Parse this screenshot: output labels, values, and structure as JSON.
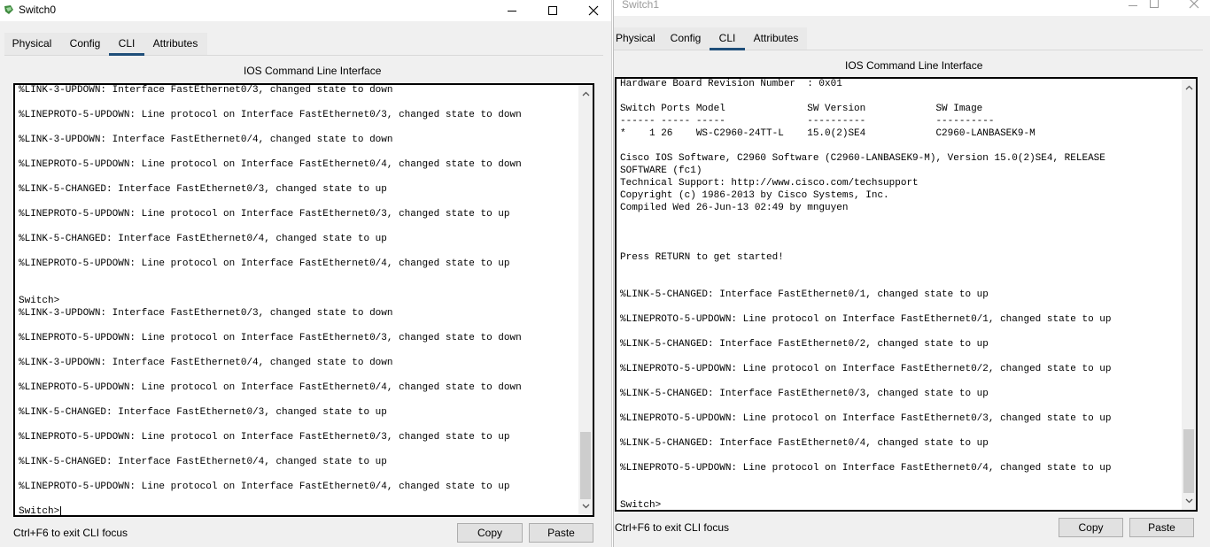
{
  "switch0": {
    "title": "Switch0",
    "tabs": [
      {
        "label": "Physical",
        "active": false
      },
      {
        "label": "Config",
        "active": false
      },
      {
        "label": "CLI",
        "active": true
      },
      {
        "label": "Attributes",
        "active": false
      }
    ],
    "section_title": "IOS Command Line Interface",
    "cli_lines": [
      "%LINK-3-UPDOWN: Interface FastEthernet0/3, changed state to down",
      "",
      "%LINEPROTO-5-UPDOWN: Line protocol on Interface FastEthernet0/3, changed state to down",
      "",
      "%LINK-3-UPDOWN: Interface FastEthernet0/4, changed state to down",
      "",
      "%LINEPROTO-5-UPDOWN: Line protocol on Interface FastEthernet0/4, changed state to down",
      "",
      "%LINK-5-CHANGED: Interface FastEthernet0/3, changed state to up",
      "",
      "%LINEPROTO-5-UPDOWN: Line protocol on Interface FastEthernet0/3, changed state to up",
      "",
      "%LINK-5-CHANGED: Interface FastEthernet0/4, changed state to up",
      "",
      "%LINEPROTO-5-UPDOWN: Line protocol on Interface FastEthernet0/4, changed state to up",
      "",
      "",
      "Switch>",
      "%LINK-3-UPDOWN: Interface FastEthernet0/3, changed state to down",
      "",
      "%LINEPROTO-5-UPDOWN: Line protocol on Interface FastEthernet0/3, changed state to down",
      "",
      "%LINK-3-UPDOWN: Interface FastEthernet0/4, changed state to down",
      "",
      "%LINEPROTO-5-UPDOWN: Line protocol on Interface FastEthernet0/4, changed state to down",
      "",
      "%LINK-5-CHANGED: Interface FastEthernet0/3, changed state to up",
      "",
      "%LINEPROTO-5-UPDOWN: Line protocol on Interface FastEthernet0/3, changed state to up",
      "",
      "%LINK-5-CHANGED: Interface FastEthernet0/4, changed state to up",
      "",
      "%LINEPROTO-5-UPDOWN: Line protocol on Interface FastEthernet0/4, changed state to up",
      "",
      "Switch>"
    ],
    "hint": "Ctrl+F6 to exit CLI focus",
    "copy_label": "Copy",
    "paste_label": "Paste"
  },
  "switch1": {
    "title": "Switch1",
    "tabs": [
      {
        "label": "Physical",
        "active": false
      },
      {
        "label": "Config",
        "active": false
      },
      {
        "label": "CLI",
        "active": true
      },
      {
        "label": "Attributes",
        "active": false
      }
    ],
    "section_title": "IOS Command Line Interface",
    "cli_lines": [
      "Hardware Board Revision Number  : 0x01",
      "",
      "Switch Ports Model              SW Version            SW Image",
      "------ ----- -----              ----------            ----------",
      "*    1 26    WS-C2960-24TT-L    15.0(2)SE4            C2960-LANBASEK9-M",
      "",
      "Cisco IOS Software, C2960 Software (C2960-LANBASEK9-M), Version 15.0(2)SE4, RELEASE",
      "SOFTWARE (fc1)",
      "Technical Support: http://www.cisco.com/techsupport",
      "Copyright (c) 1986-2013 by Cisco Systems, Inc.",
      "Compiled Wed 26-Jun-13 02:49 by mnguyen",
      "",
      "",
      "",
      "Press RETURN to get started!",
      "",
      "",
      "%LINK-5-CHANGED: Interface FastEthernet0/1, changed state to up",
      "",
      "%LINEPROTO-5-UPDOWN: Line protocol on Interface FastEthernet0/1, changed state to up",
      "",
      "%LINK-5-CHANGED: Interface FastEthernet0/2, changed state to up",
      "",
      "%LINEPROTO-5-UPDOWN: Line protocol on Interface FastEthernet0/2, changed state to up",
      "",
      "%LINK-5-CHANGED: Interface FastEthernet0/3, changed state to up",
      "",
      "%LINEPROTO-5-UPDOWN: Line protocol on Interface FastEthernet0/3, changed state to up",
      "",
      "%LINK-5-CHANGED: Interface FastEthernet0/4, changed state to up",
      "",
      "%LINEPROTO-5-UPDOWN: Line protocol on Interface FastEthernet0/4, changed state to up",
      "",
      "",
      "Switch>"
    ],
    "hint": "Ctrl+F6 to exit CLI focus",
    "copy_label": "Copy",
    "paste_label": "Paste"
  },
  "colors": {
    "tab_underline": "#1f4e79",
    "cli_border": "#000000",
    "inactive_title": "#9a9a9a"
  }
}
